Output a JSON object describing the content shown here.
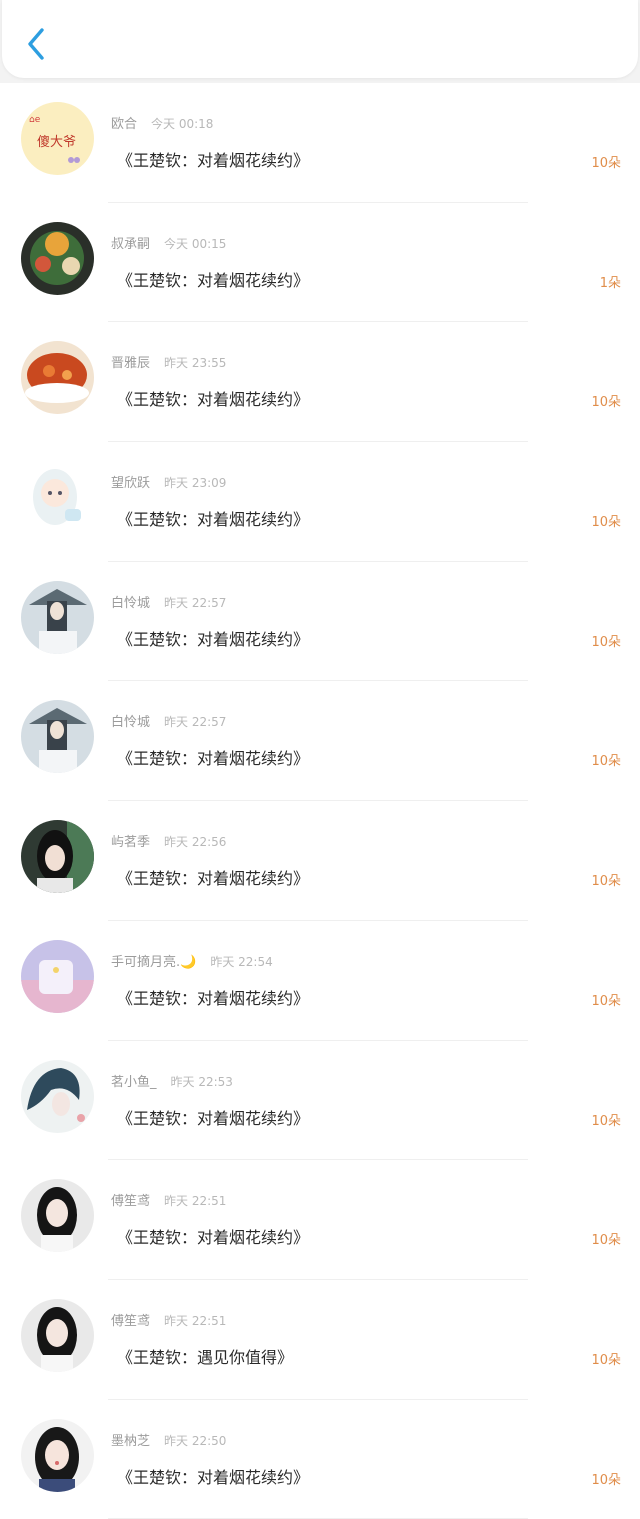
{
  "header": {
    "back_icon": "chevron-left-icon",
    "accent_color": "#2d9ee0"
  },
  "items": [
    {
      "name": "欧合",
      "time": "今天 00:18",
      "title": "《王楚钦：对着烟花续约》",
      "count": "10朵"
    },
    {
      "name": "叔承嗣",
      "time": "今天 00:15",
      "title": "《王楚钦：对着烟花续约》",
      "count": "1朵"
    },
    {
      "name": "晋雅辰",
      "time": "昨天 23:55",
      "title": "《王楚钦：对着烟花续约》",
      "count": "10朵"
    },
    {
      "name": "望欣跃",
      "time": "昨天 23:09",
      "title": "《王楚钦：对着烟花续约》",
      "count": "10朵"
    },
    {
      "name": "白怜城",
      "time": "昨天 22:57",
      "title": "《王楚钦：对着烟花续约》",
      "count": "10朵"
    },
    {
      "name": "白怜城",
      "time": "昨天 22:57",
      "title": "《王楚钦：对着烟花续约》",
      "count": "10朵"
    },
    {
      "name": "屿茗季",
      "time": "昨天 22:56",
      "title": "《王楚钦：对着烟花续约》",
      "count": "10朵"
    },
    {
      "name": "手可摘月亮.🌙",
      "time": "昨天 22:54",
      "title": "《王楚钦：对着烟花续约》",
      "count": "10朵"
    },
    {
      "name": "茗小鱼_",
      "time": "昨天 22:53",
      "title": "《王楚钦：对着烟花续约》",
      "count": "10朵"
    },
    {
      "name": "傅笙鸢",
      "time": "昨天 22:51",
      "title": "《王楚钦：对着烟花续约》",
      "count": "10朵"
    },
    {
      "name": "傅笙鸢",
      "time": "昨天 22:51",
      "title": "《王楚钦：遇见你值得》",
      "count": "10朵"
    },
    {
      "name": "墨枘芝",
      "time": "昨天 22:50",
      "title": "《王楚钦：对着烟花续约》",
      "count": "10朵"
    }
  ]
}
